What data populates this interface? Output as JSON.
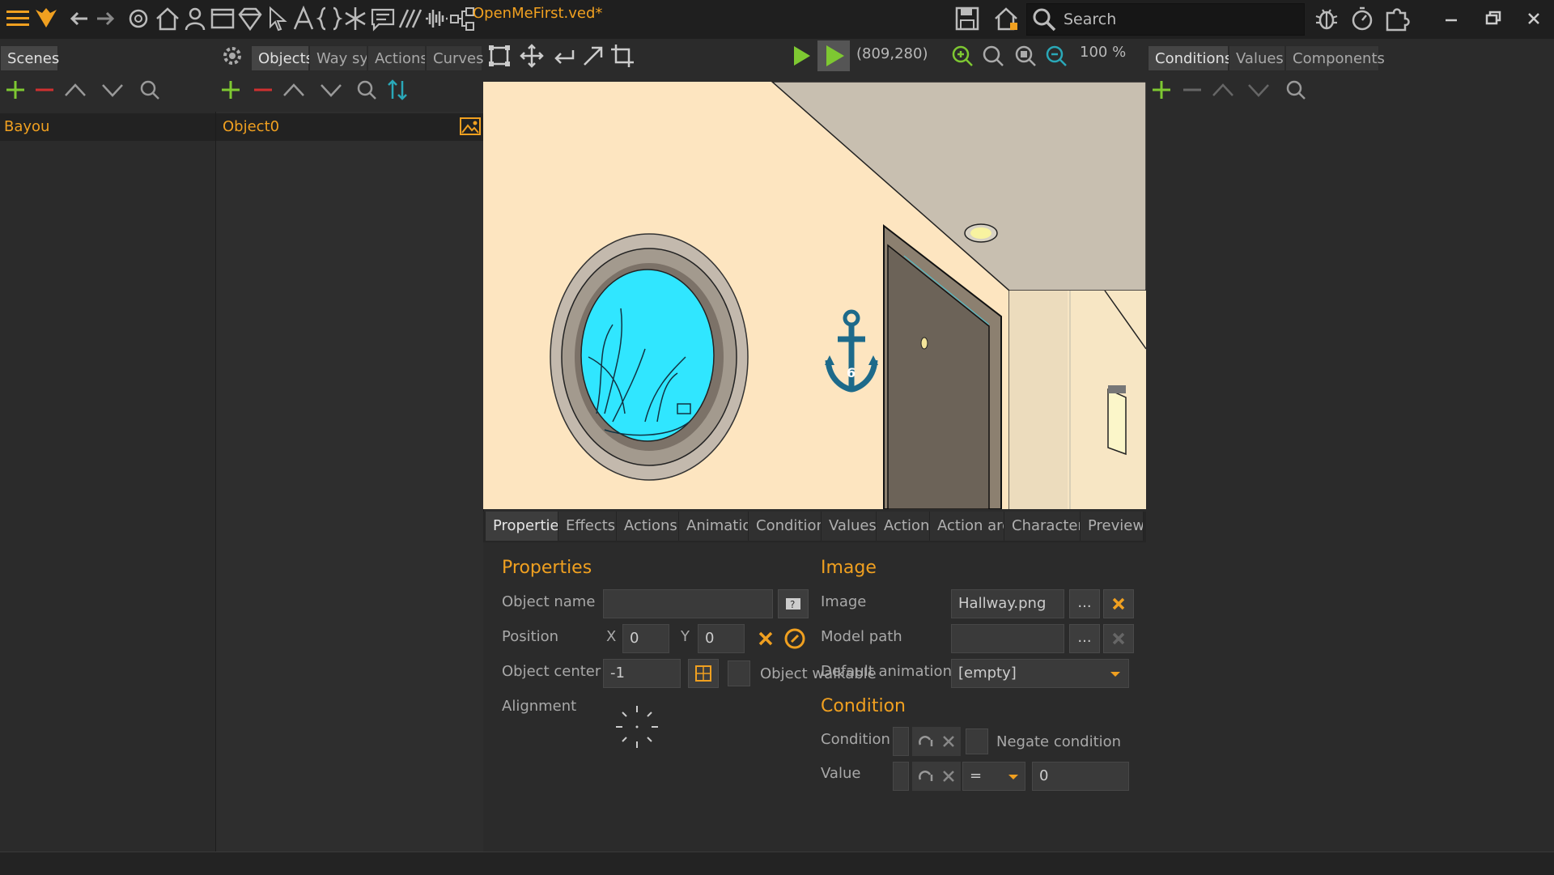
{
  "app": {
    "title": "OpenMeFirst.ved*"
  },
  "search": {
    "placeholder": "Search"
  },
  "left_tabs": {
    "scenes": "Scenes"
  },
  "mid_tabs": {
    "objects": "Objects",
    "way_sys": "Way sys",
    "actions": "Actions",
    "curves": "Curves"
  },
  "viewport_bar": {
    "coords": "(809,280)",
    "zoom": "100 %"
  },
  "right_tabs": {
    "conditions": "Conditions",
    "values": "Values",
    "components": "Components"
  },
  "scenes": {
    "items": [
      "Bayou"
    ]
  },
  "objects": {
    "items": [
      "Object0"
    ]
  },
  "props_tabs": [
    "Properties",
    "Effects",
    "Actions",
    "Animations",
    "Conditions",
    "Values",
    "Action",
    "Action area",
    "Character",
    "Preview"
  ],
  "properties": {
    "heading": "Properties",
    "object_name_label": "Object name",
    "object_name_value": "",
    "position_label": "Position",
    "x_label": "X",
    "x_value": "0",
    "y_label": "Y",
    "y_value": "0",
    "object_center_label": "Object center",
    "object_center_value": "-1",
    "object_walkable_label": "Object walkable",
    "alignment_label": "Alignment"
  },
  "image": {
    "heading": "Image",
    "image_label": "Image",
    "image_value": "Hallway.png",
    "model_path_label": "Model path",
    "model_path_value": "",
    "default_animation_label": "Default animation",
    "default_animation_value": "[empty]",
    "browse_label": "..."
  },
  "condition": {
    "heading": "Condition",
    "condition_label": "Condition",
    "negate_label": "Negate condition",
    "value_label": "Value",
    "operator_value": "=",
    "value_value": "0"
  },
  "scene_art": {
    "anchor_number": "6"
  },
  "colors": {
    "accent": "#f0a020",
    "green": "#7ec832",
    "red": "#d03030",
    "teal": "#2aa8b8",
    "wall": "#fde5c0",
    "porthole_water": "#30e6ff"
  }
}
